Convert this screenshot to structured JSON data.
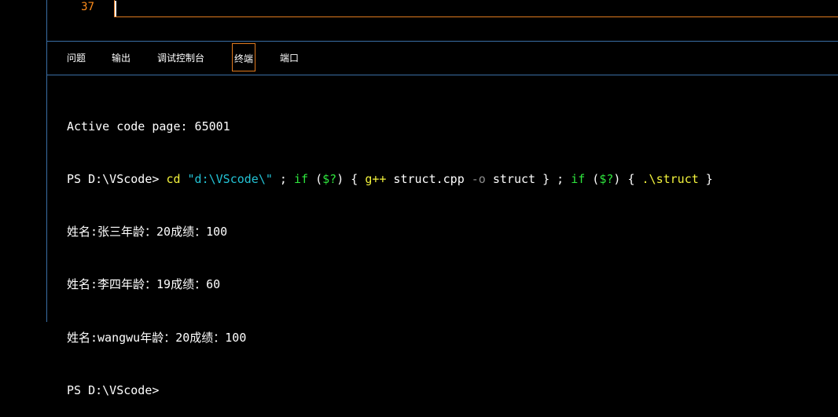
{
  "editor": {
    "line_number": "37"
  },
  "panel_tabs": [
    {
      "label": "问题",
      "active": false
    },
    {
      "label": "输出",
      "active": false
    },
    {
      "label": "调试控制台",
      "active": false
    },
    {
      "label": "终端",
      "active": true
    },
    {
      "label": "端口",
      "active": false
    }
  ],
  "terminal": {
    "active_code_page": "Active code page: 65001",
    "prompt": "PS D:\\VScode>",
    "command": {
      "cd": "cd",
      "path_arg": "\"d:\\VScode\\\"",
      "sep1": " ; ",
      "if1": "if",
      "paren_open1": " (",
      "cond1": "$?",
      "paren_close1": ") { ",
      "gpp": "g++",
      "gpp_args": " struct.cpp ",
      "flag_o": "-o",
      "out_name": " struct } ; ",
      "if2": "if",
      "paren_open2": " (",
      "cond2": "$?",
      "paren_close2": ") { ",
      "run": ".\\struct",
      "close": " }"
    },
    "output_lines": [
      "姓名:张三年龄：20成绩：100",
      "姓名:李四年龄：19成绩：60",
      "姓名:wangwu年龄：20成绩：100"
    ],
    "final_prompt": "PS D:\\VScode>"
  },
  "colors": {
    "background": "#000000",
    "border_blue": "#3a6ea5",
    "accent_orange": "#e07a1f",
    "line_number_orange": "#ff8c1a",
    "cmd_yellow": "#f2f23c",
    "string_cyan": "#23c2d4",
    "param_gray": "#8c8c8c",
    "green": "#2ee53d"
  }
}
